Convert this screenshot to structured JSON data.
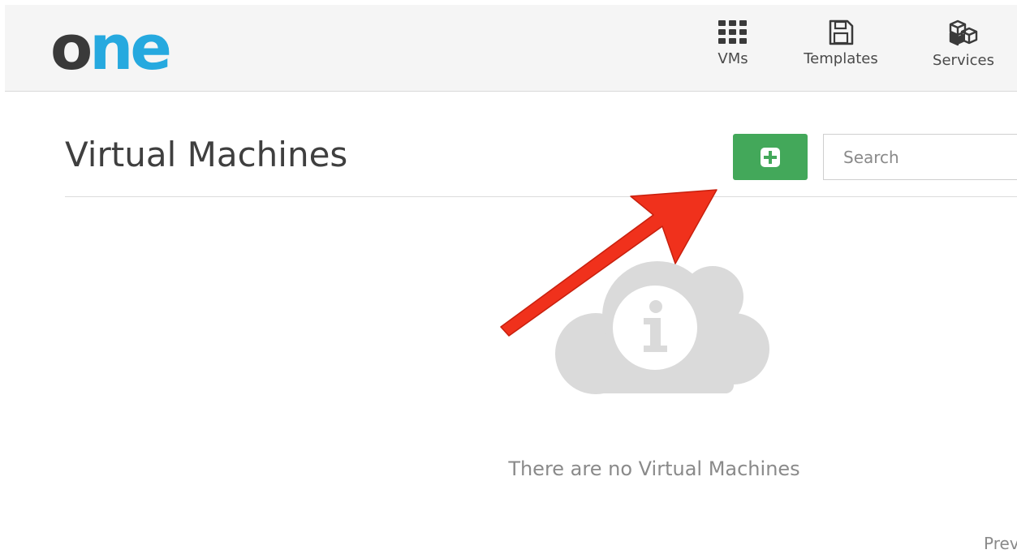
{
  "header": {
    "logo": {
      "part1": "o",
      "part2": "ne"
    },
    "nav": [
      {
        "label": "VMs",
        "icon": "grid-icon"
      },
      {
        "label": "Templates",
        "icon": "save-icon"
      },
      {
        "label": "Services",
        "icon": "cubes-icon"
      }
    ]
  },
  "main": {
    "title": "Virtual Machines",
    "add_button": {
      "icon": "plus-square-icon",
      "color": "#43a85a"
    },
    "search": {
      "placeholder": "Search",
      "value": ""
    },
    "empty_state": {
      "icon": "cloud-info-icon",
      "message": "There are no Virtual Machines"
    },
    "pagination": {
      "prev_label": "Prev"
    }
  },
  "annotation": {
    "type": "arrow",
    "color": "#f0311c",
    "points_to": "add-button"
  },
  "colors": {
    "brand_dark": "#3a3a3a",
    "brand_blue": "#26a9df",
    "add_green": "#43a85a"
  }
}
